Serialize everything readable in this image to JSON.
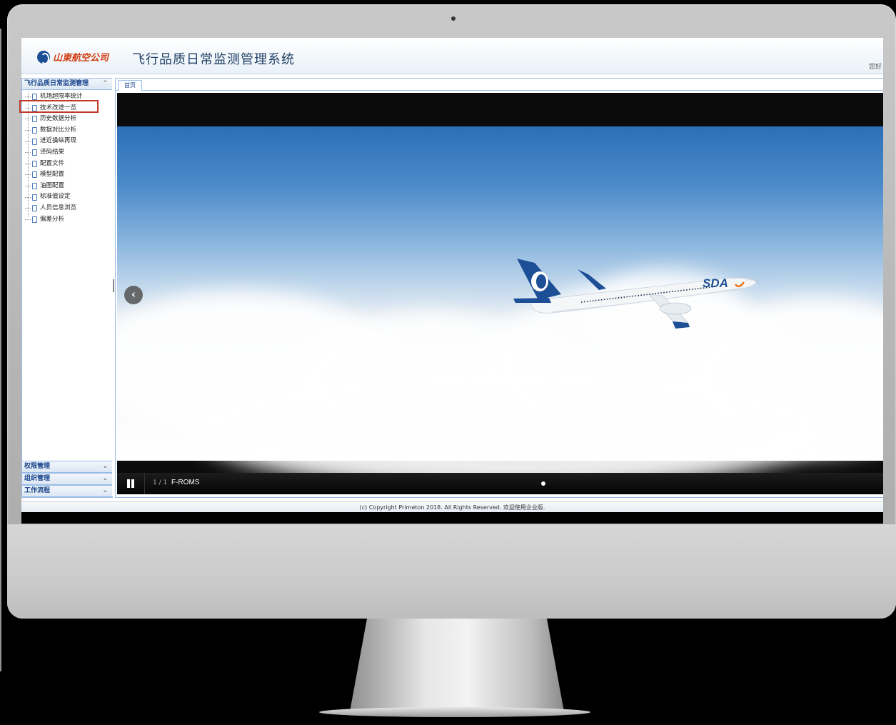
{
  "header": {
    "logo_text": "山東航空公司",
    "system_title": "飞行品质日常监测管理系统",
    "greeting": "您好"
  },
  "sidebar": {
    "section_title": "飞行品质日常监测管理",
    "items": [
      {
        "label": "机场超限率统计"
      },
      {
        "label": "技术改进一览",
        "highlighted": true
      },
      {
        "label": "历史数据分析"
      },
      {
        "label": "数据对比分析"
      },
      {
        "label": "进近操纵再现"
      },
      {
        "label": "译码结果"
      },
      {
        "label": "配置文件"
      },
      {
        "label": "模型配置"
      },
      {
        "label": "油图配置"
      },
      {
        "label": "标准值设定"
      },
      {
        "label": "人员信息浏览"
      },
      {
        "label": "偏差分析"
      }
    ],
    "bottom_sections": [
      {
        "label": "权限管理"
      },
      {
        "label": "组织管理"
      },
      {
        "label": "工作流程"
      }
    ],
    "highlight_color": "#c0392b"
  },
  "main": {
    "tab_label": "首页",
    "slider": {
      "counter": "1 / 1",
      "title": "F-ROMS",
      "plane_livery": "SDA"
    }
  },
  "footer": {
    "text": "(c) Copyright Primeton 2018. All Rights Reserved. 欢迎使用企业版."
  },
  "colors": {
    "brand": "#1d4f96",
    "accent": "#cf3d12",
    "panel_border": "#99bbe8"
  }
}
